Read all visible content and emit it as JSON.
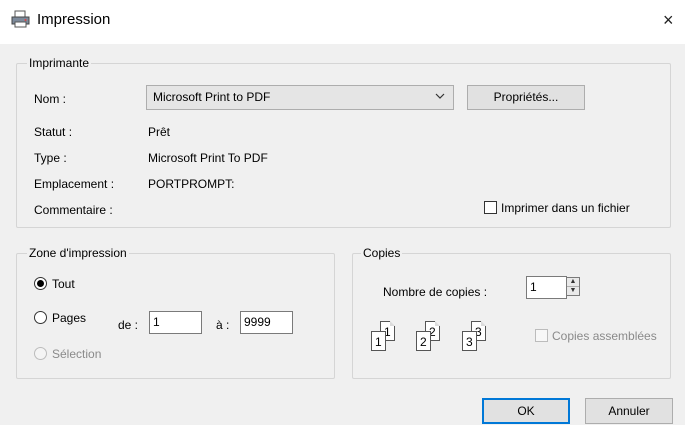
{
  "window": {
    "title": "Impression",
    "close_glyph": "×"
  },
  "printer": {
    "group_label": "Imprimante",
    "name_label": "Nom :",
    "name_value": "Microsoft Print to PDF",
    "properties_button": "Propriétés...",
    "status_label": "Statut :",
    "status_value": "Prêt",
    "type_label": "Type :",
    "type_value": "Microsoft Print To PDF",
    "location_label": "Emplacement :",
    "location_value": "PORTPROMPT:",
    "comment_label": "Commentaire :",
    "print_to_file_label": "Imprimer dans un fichier",
    "print_to_file_checked": false
  },
  "print_range": {
    "group_label": "Zone d'impression",
    "all_label": "Tout",
    "pages_label": "Pages",
    "from_label": "de :",
    "from_value": "1",
    "to_label": "à :",
    "to_value": "9999",
    "selection_label": "Sélection",
    "selected": "all"
  },
  "copies": {
    "group_label": "Copies",
    "count_label": "Nombre de copies :",
    "count_value": "1",
    "collate_label": "Copies assemblées",
    "collate_enabled": false,
    "pages_icons": [
      {
        "back": "1",
        "front": "1"
      },
      {
        "back": "2",
        "front": "2"
      },
      {
        "back": "3",
        "front": "3"
      }
    ]
  },
  "buttons": {
    "ok": "OK",
    "cancel": "Annuler"
  },
  "icons": {
    "app": "printer-icon",
    "dropdown": "chevron-down-icon"
  }
}
